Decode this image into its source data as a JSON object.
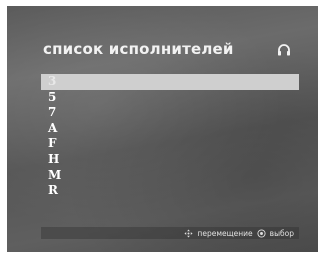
{
  "header": {
    "title": "список исполнителей",
    "icon": "headphones-icon"
  },
  "list": {
    "items": [
      {
        "label": "3",
        "selected": true
      },
      {
        "label": "5",
        "selected": false
      },
      {
        "label": "7",
        "selected": false
      },
      {
        "label": "A",
        "selected": false
      },
      {
        "label": "F",
        "selected": false
      },
      {
        "label": "H",
        "selected": false
      },
      {
        "label": "M",
        "selected": false
      },
      {
        "label": "R",
        "selected": false
      }
    ]
  },
  "footer": {
    "navigate_label": "перемещение",
    "navigate_icon": "dpad-icon",
    "select_label": "выбор",
    "select_icon": "ok-button-icon"
  },
  "colors": {
    "highlight": "#cfcfcf",
    "text": "#ffffff"
  }
}
